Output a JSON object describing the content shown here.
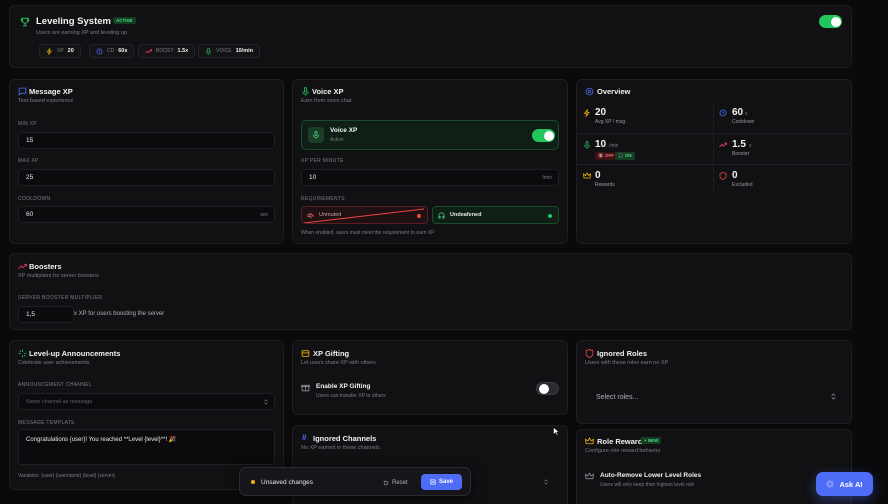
{
  "header": {
    "title": "Leveling System",
    "status_badge": "ACTIVE",
    "subtitle": "Users are earning XP and leveling up",
    "enabled": true,
    "pills": [
      {
        "key": "XP",
        "value": "20"
      },
      {
        "key": "CD",
        "value": "60s"
      },
      {
        "key": "BOOST",
        "value": "1.5x"
      },
      {
        "key": "VOICE",
        "value": "10/min"
      }
    ]
  },
  "message_xp": {
    "title": "Message XP",
    "subtitle": "Text-based experience",
    "min_label": "MIN XP",
    "min_value": "15",
    "max_label": "MAX XP",
    "max_value": "25",
    "cooldown_label": "COOLDOWN",
    "cooldown_value": "60",
    "cooldown_unit": "sec"
  },
  "voice_xp": {
    "title": "Voice XP",
    "subtitle": "Earn from voice chat",
    "toggle_title": "Voice XP",
    "toggle_status": "Active",
    "enabled": true,
    "per_minute_label": "XP PER MINUTE",
    "per_minute_value": "10",
    "per_minute_unit": "/min",
    "requirements_label": "REQUIREMENTS",
    "req_unmuted": "Unmuted",
    "req_undeafened": "Undeafened",
    "requirements_note": "When enabled, users must meet the requirement to earn XP"
  },
  "overview": {
    "title": "Overview",
    "stats": [
      {
        "value": "20",
        "unit": "",
        "label": "Avg XP / msg"
      },
      {
        "value": "60",
        "unit": "s",
        "label": "Cooldown"
      },
      {
        "value": "10",
        "unit": "/min",
        "label": ""
      },
      {
        "value": "1.5",
        "unit": "x",
        "label": "Booster"
      },
      {
        "value": "0",
        "unit": "",
        "label": "Rewards"
      },
      {
        "value": "0",
        "unit": "",
        "label": "Excluded"
      }
    ],
    "voice_badge_off": "🔇 OFF",
    "voice_badge_on": "🎧 ON"
  },
  "boosters": {
    "title": "Boosters",
    "subtitle": "XP multipliers for server boosters",
    "multiplier_label": "SERVER BOOSTER MULTIPLIER",
    "multiplier_value": "1,5",
    "multiplier_note": "x XP for users boosting the server"
  },
  "levelup": {
    "title": "Level-up Announcements",
    "subtitle": "Celebrate user achievements",
    "channel_label": "ANNOUNCEMENT CHANNEL",
    "channel_placeholder": "Same channel as message",
    "template_label": "MESSAGE TEMPLATE",
    "template_value": "Congratulations {user}! You reached **Level {level}**! 🎉",
    "variables_note": "Variables: {user} {username} {level} {server}"
  },
  "gifting": {
    "title": "XP Gifting",
    "subtitle": "Let users share XP with others",
    "toggle_title": "Enable XP Gifting",
    "toggle_sub": "Users can transfer XP to others",
    "enabled": false
  },
  "ignored_channels": {
    "title": "Ignored Channels",
    "subtitle": "No XP earned in these channels"
  },
  "ignored_roles": {
    "title": "Ignored Roles",
    "subtitle": "Users with these roles earn no XP",
    "placeholder": "Select roles..."
  },
  "role_rewards": {
    "title": "Role Rewards",
    "badge": "+ NEW",
    "subtitle": "Configure role reward behavior",
    "auto_remove_title": "Auto-Remove Lower Level Roles",
    "auto_remove_sub": "Users will only keep their highest level role"
  },
  "save_bar": {
    "status": "Unsaved changes",
    "reset_label": "Reset",
    "save_label": "Save"
  },
  "ask_ai": {
    "label": "Ask AI"
  },
  "colors": {
    "accent_green": "#22c55e",
    "brand_blue": "#4f6cf6",
    "warn_yellow": "#eab308",
    "danger_red": "#ef4444"
  }
}
